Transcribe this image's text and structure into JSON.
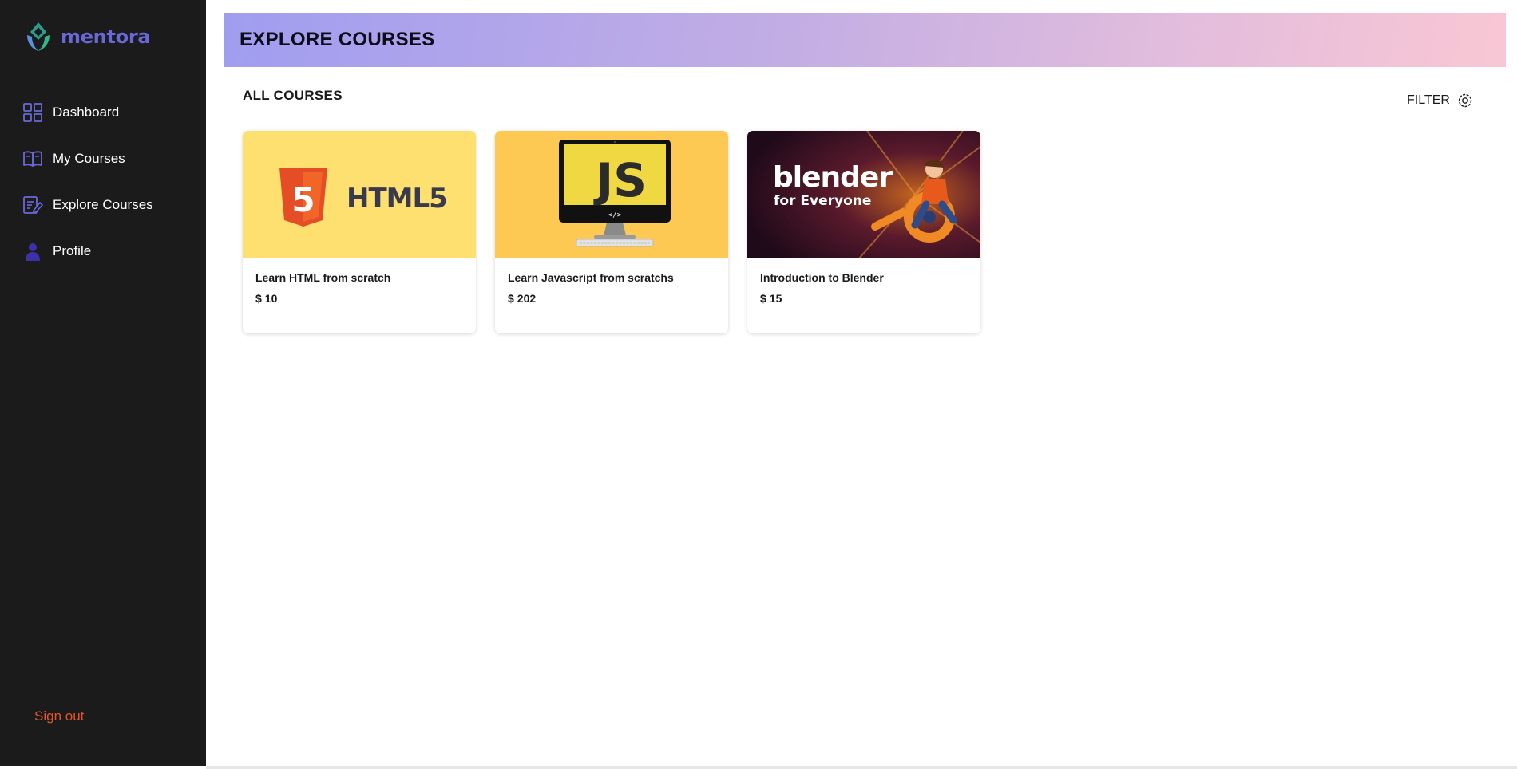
{
  "brand": {
    "name": "mentora"
  },
  "sidebar": {
    "items": [
      {
        "label": "Dashboard",
        "icon": "grid-icon"
      },
      {
        "label": "My Courses",
        "icon": "book-icon"
      },
      {
        "label": "Explore Courses",
        "icon": "edit-list-icon"
      },
      {
        "label": "Profile",
        "icon": "user-icon"
      }
    ],
    "signout": "Sign out"
  },
  "header": {
    "title": "EXPLORE COURSES"
  },
  "main": {
    "section_title": "ALL COURSES",
    "filter_label": "FILTER",
    "courses": [
      {
        "title": "Learn HTML from scratch",
        "currency": "$",
        "price": "10",
        "thumb_text": "HTML5",
        "thumb_badge": "5"
      },
      {
        "title": "Learn Javascript from scratchs",
        "currency": "$",
        "price": "202",
        "thumb_text": "JS",
        "thumb_code": "</>"
      },
      {
        "title": "Introduction to Blender",
        "currency": "$",
        "price": "15",
        "thumb_text": "blender",
        "thumb_sub": "for Everyone"
      }
    ]
  },
  "colors": {
    "sidebar_bg": "#1b1b1b",
    "brand": "#6a68d8",
    "signout": "#e0542a",
    "html_bg": "#fde06f",
    "js_bg": "#fec953",
    "blender_bg": "#2a0f22"
  }
}
